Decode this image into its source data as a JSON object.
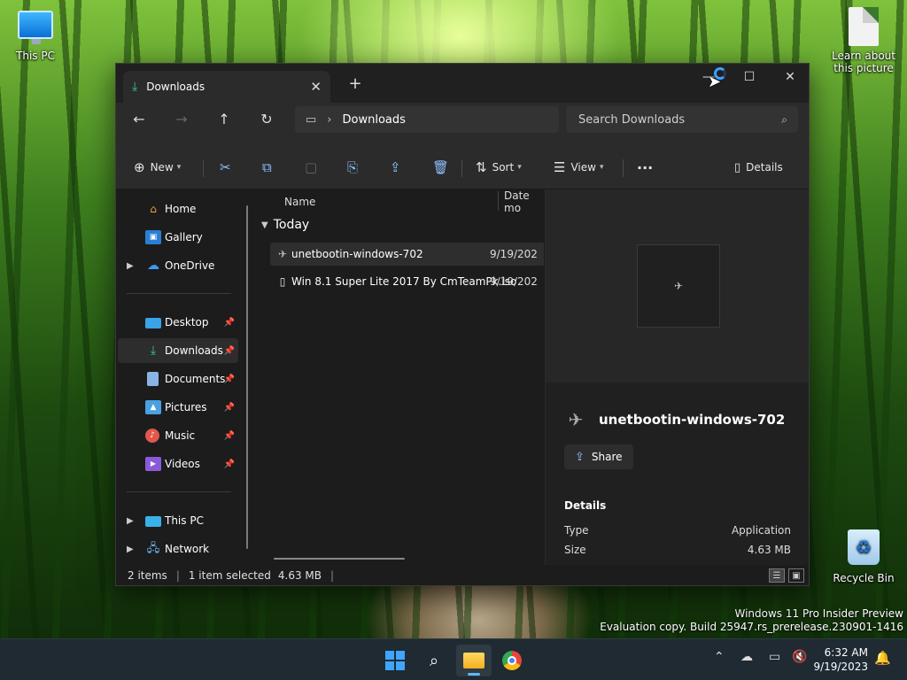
{
  "desktop": {
    "icons": {
      "this_pc": "This PC",
      "learn": "Learn about this picture",
      "recycle_bin": "Recycle Bin"
    },
    "watermark": {
      "line1": "Windows 11 Pro Insider Preview",
      "line2": "Evaluation copy. Build 25947.rs_prerelease.230901-1416"
    }
  },
  "window": {
    "tab": {
      "label": "Downloads",
      "icon": "download-icon"
    },
    "new_tab": "+",
    "controls": {
      "minimize": "—",
      "maximize": "☐",
      "close": "✕"
    },
    "address": {
      "location": "Downloads"
    },
    "search": {
      "placeholder": "Search Downloads"
    },
    "commandbar": {
      "new_label": "New",
      "sort_label": "Sort",
      "view_label": "View",
      "more_label": "···",
      "details_label": "Details"
    },
    "nav": {
      "items": [
        {
          "label": "Home",
          "icon": "home-icon"
        },
        {
          "label": "Gallery",
          "icon": "gallery-icon"
        },
        {
          "label": "OneDrive",
          "icon": "cloud-icon"
        },
        {
          "label": "Desktop",
          "icon": "desktop-icon"
        },
        {
          "label": "Downloads",
          "icon": "download-icon"
        },
        {
          "label": "Documents",
          "icon": "document-icon"
        },
        {
          "label": "Pictures",
          "icon": "picture-icon"
        },
        {
          "label": "Music",
          "icon": "music-icon"
        },
        {
          "label": "Videos",
          "icon": "video-icon"
        },
        {
          "label": "This PC",
          "icon": "pc-icon"
        },
        {
          "label": "Network",
          "icon": "network-icon"
        }
      ]
    },
    "filelist": {
      "columns": {
        "name": "Name",
        "date": "Date mo"
      },
      "group": "Today",
      "files": [
        {
          "name": "unetbootin-windows-702",
          "date": "9/19/202",
          "icon": "app-icon"
        },
        {
          "name": "Win 8.1 Super Lite 2017 By CmTeamPk.iso",
          "date": "9/19/202",
          "icon": "file-icon"
        }
      ]
    },
    "details": {
      "title": "unetbootin-windows-702",
      "share_label": "Share",
      "section_label": "Details",
      "properties": [
        {
          "key": "Type",
          "value": "Application"
        },
        {
          "key": "Size",
          "value": "4.63 MB"
        }
      ]
    },
    "status": {
      "items": "2 items",
      "selection": "1 item selected",
      "size": "4.63 MB",
      "separator": "|"
    }
  },
  "taskbar": {
    "time": "6:32 AM",
    "date": "9/19/2023"
  }
}
